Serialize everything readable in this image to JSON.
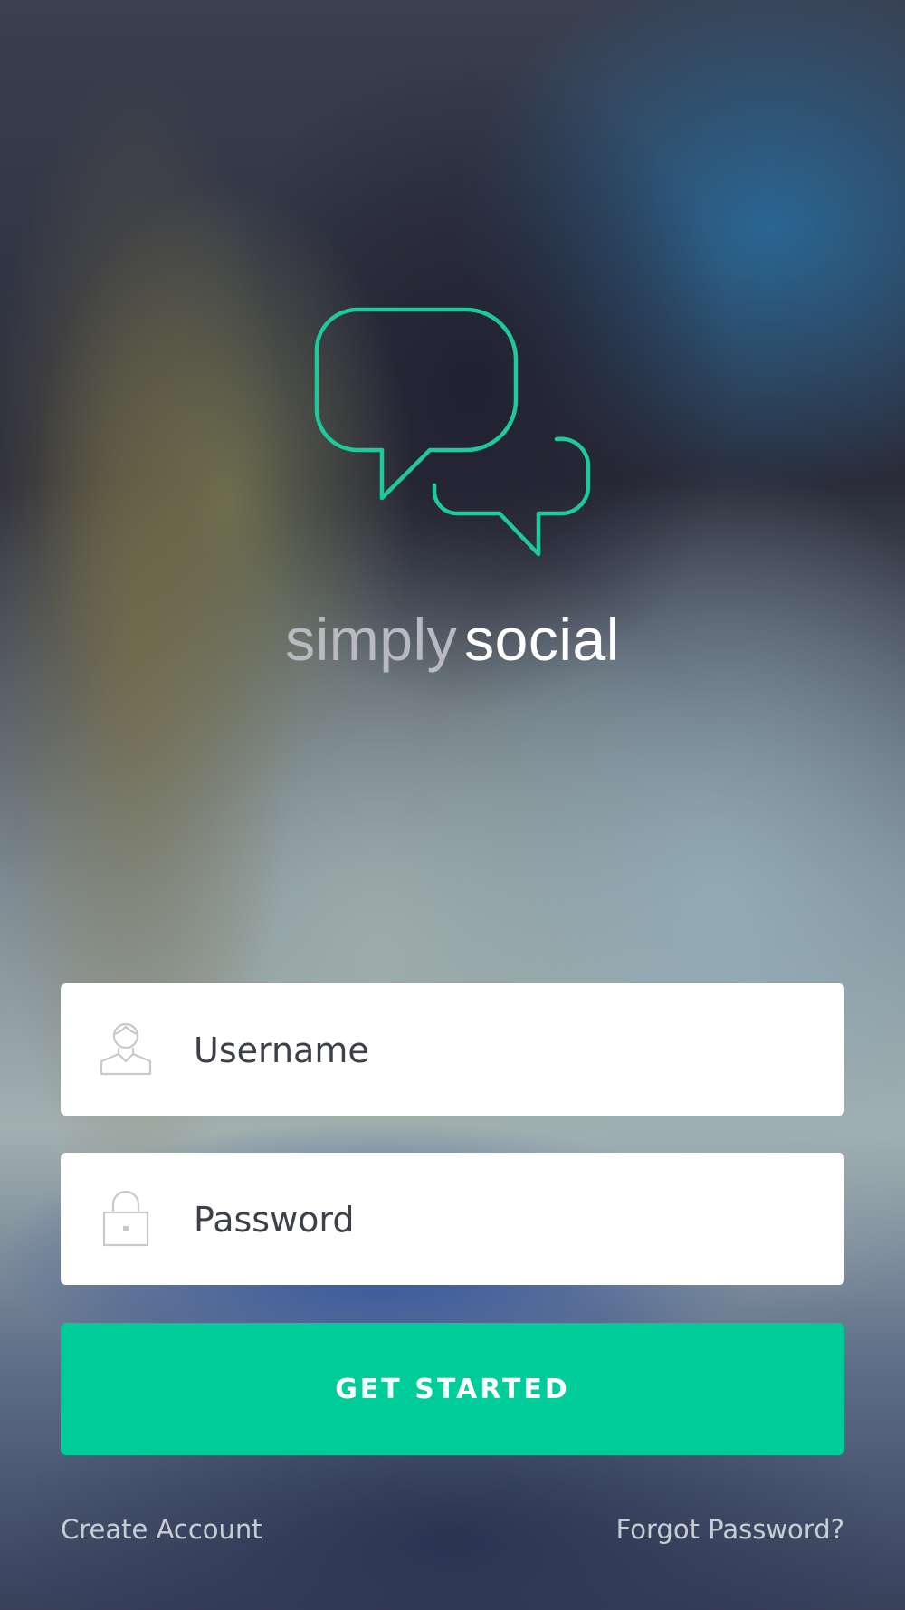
{
  "brand": {
    "word1": "simply",
    "word2": "social",
    "accent_color": "#00cc9a",
    "logo_icon": "chat-bubbles-icon"
  },
  "form": {
    "username": {
      "placeholder": "Username",
      "value": "",
      "icon": "user-icon"
    },
    "password": {
      "placeholder": "Password",
      "value": "",
      "icon": "lock-icon"
    },
    "submit_label": "GET STARTED"
  },
  "footer": {
    "create_account": "Create Account",
    "forgot_password": "Forgot Password?"
  }
}
